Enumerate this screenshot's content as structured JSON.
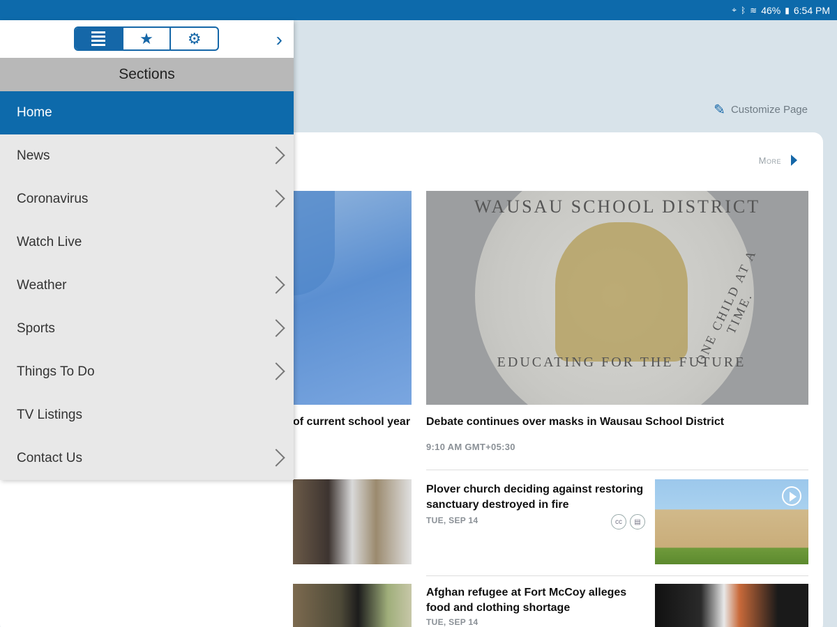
{
  "status": {
    "battery": "46%",
    "time": "6:54 PM",
    "icons": [
      "location-icon",
      "bluetooth-icon",
      "wifi-icon",
      "battery-icon"
    ]
  },
  "page": {
    "customize_label": "Customize Page",
    "more_label": "More"
  },
  "stories": {
    "left_headline_fragment": "of current school year",
    "main_headline": "Debate continues over masks in Wausau School District",
    "main_meta": "9:10 AM GMT+05:30",
    "seal_top": "WAUSAU SCHOOL DISTRICT",
    "seal_right": "ONE CHILD AT A TIME.",
    "seal_bottom": "EDUCATING FOR THE FUTURE",
    "story2_title": "Plover church deciding against restoring sanctuary destroyed in fire",
    "story2_date": "TUE, SEP 14",
    "story3_title": "Afghan refugee at Fort McCoy alleges food and clothing shortage",
    "story3_date": "TUE, SEP 14"
  },
  "drawer": {
    "title": "Sections",
    "tabs": [
      "list-icon",
      "star-icon",
      "gear-icon"
    ],
    "items": [
      {
        "label": "Home",
        "active": true,
        "has_children": false
      },
      {
        "label": "News",
        "has_children": true
      },
      {
        "label": "Coronavirus",
        "has_children": true
      },
      {
        "label": "Watch Live",
        "has_children": false
      },
      {
        "label": "Weather",
        "has_children": true
      },
      {
        "label": "Sports",
        "has_children": true
      },
      {
        "label": "Things To Do",
        "has_children": true
      },
      {
        "label": "TV Listings",
        "has_children": false
      },
      {
        "label": "Contact Us",
        "has_children": true
      }
    ]
  },
  "colors": {
    "brand_blue": "#0d6aab",
    "accent_blue": "#1567a8"
  }
}
